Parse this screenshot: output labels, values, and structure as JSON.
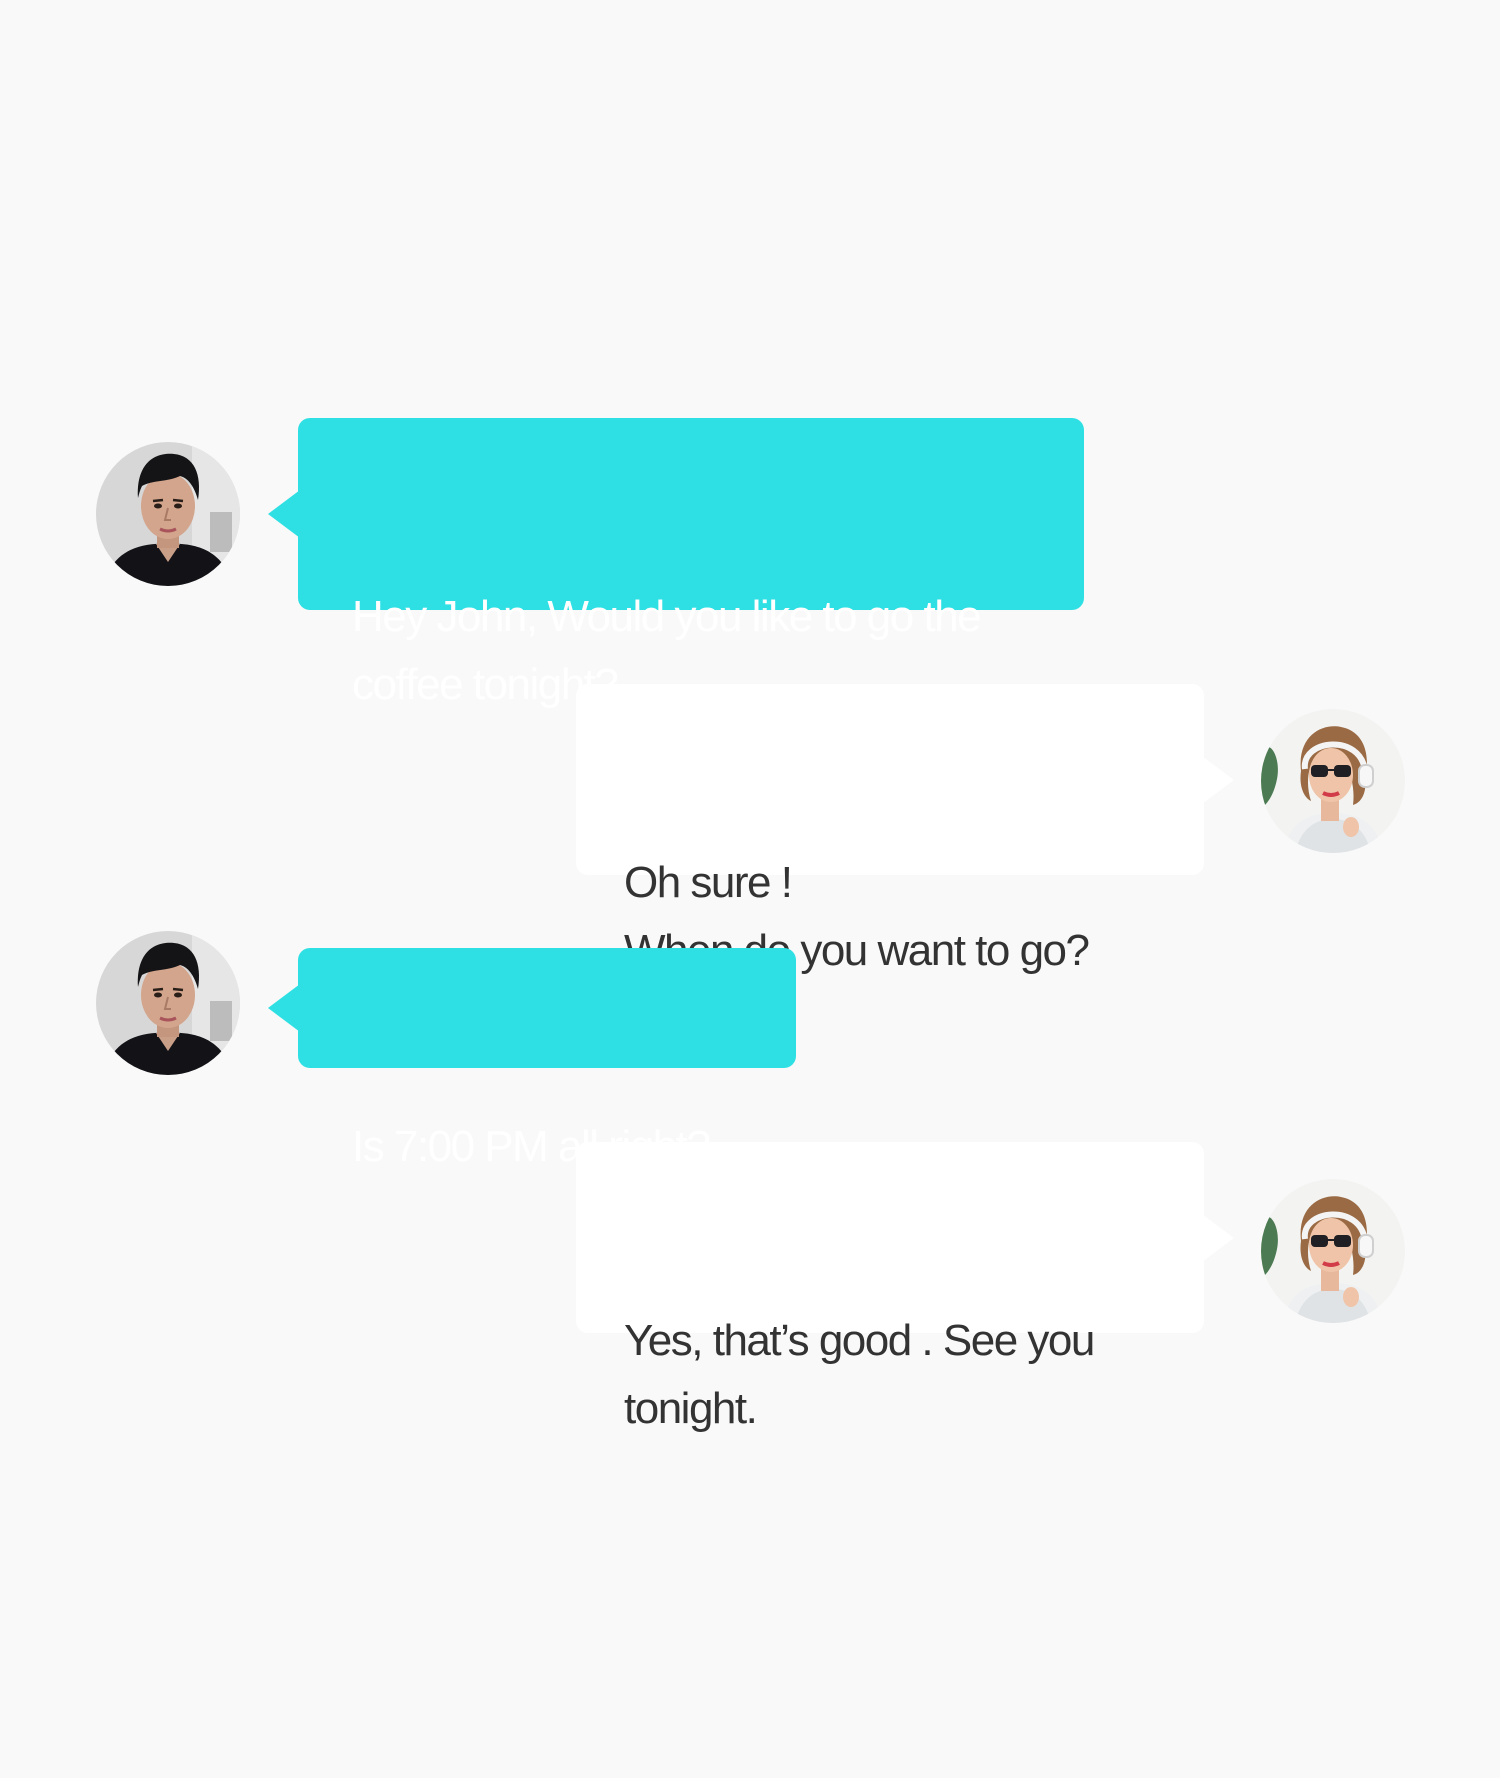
{
  "conversation": {
    "messages": [
      {
        "sender": "man",
        "direction": "incoming",
        "text": "Hey John, Would you like to go the\ncoffee tonight?",
        "avatar_icon": "man-avatar-photo"
      },
      {
        "sender": "woman",
        "direction": "outgoing",
        "text": "Oh sure !\nWhen do you want to go?",
        "avatar_icon": "woman-avatar-photo"
      },
      {
        "sender": "man",
        "direction": "incoming",
        "text": "Is 7:00 PM all right?",
        "avatar_icon": "man-avatar-photo"
      },
      {
        "sender": "woman",
        "direction": "outgoing",
        "text": "Yes, that’s good . See you\ntonight.",
        "avatar_icon": "woman-avatar-photo"
      }
    ]
  },
  "colors": {
    "background": "#f9f9f9",
    "incoming_bubble": "#2ee0e4",
    "incoming_text": "#ffffff",
    "outgoing_bubble": "#ffffff",
    "outgoing_text": "#333333"
  }
}
